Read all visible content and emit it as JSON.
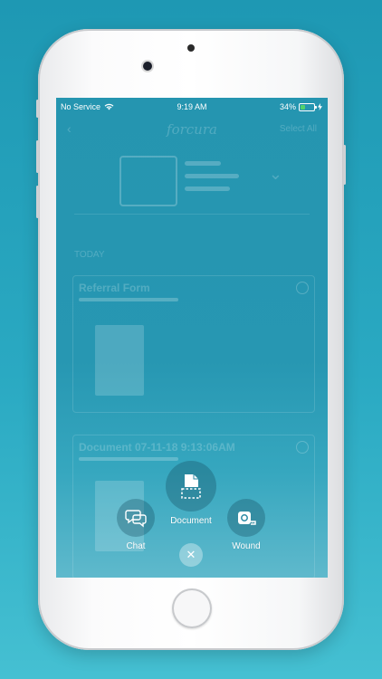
{
  "status_bar": {
    "carrier": "No Service",
    "time": "9:19 AM",
    "battery_percent": "34%",
    "battery_level": 0.34
  },
  "background_app": {
    "logo": "forcura",
    "select_all": "Select All",
    "section_label": "TODAY",
    "cards": [
      {
        "title": "Referral Form"
      },
      {
        "title": "Document 07-11-18 9:13:06AM"
      }
    ]
  },
  "actions": {
    "document_label": "Document",
    "chat_label": "Chat",
    "wound_label": "Wound",
    "close_symbol": "✕"
  },
  "colors": {
    "background_top": "#1e98b3",
    "background_bottom": "#45c0d2",
    "screen_overlay": "#2595b0",
    "battery_fill": "#53d36b"
  },
  "icons": [
    "wifi-icon",
    "charging-icon",
    "document-scan-icon",
    "chat-icon",
    "wound-measure-icon",
    "close-icon"
  ]
}
